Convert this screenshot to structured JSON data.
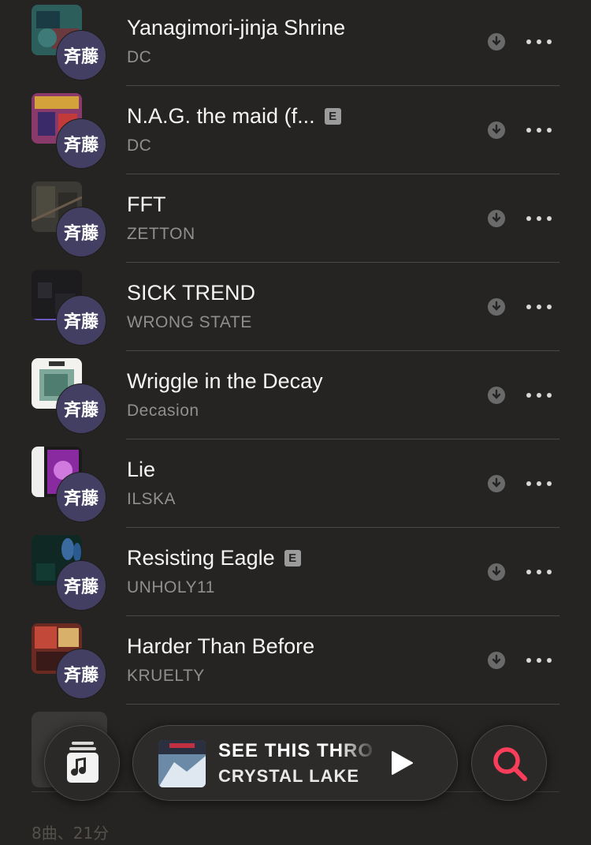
{
  "avatar_text": "斉藤",
  "explicit_badge": "E",
  "tracks": [
    {
      "title": "Yanagimori-jinja Shrine",
      "artist": "DC",
      "explicit": false
    },
    {
      "title": "N.A.G. the maid (f...",
      "artist": "DC",
      "explicit": true
    },
    {
      "title": "FFT",
      "artist": "ZETTON",
      "explicit": false
    },
    {
      "title": "SICK TREND",
      "artist": "WRONG STATE",
      "explicit": false
    },
    {
      "title": "Wriggle in the Decay",
      "artist": "Decasion",
      "explicit": false
    },
    {
      "title": "Lie",
      "artist": "ILSKA",
      "explicit": false
    },
    {
      "title": "Resisting Eagle",
      "artist": "UNHOLY11",
      "explicit": true
    },
    {
      "title": "Harder Than Before",
      "artist": "KRUELTY",
      "explicit": false
    }
  ],
  "footer": {
    "summary": "8曲、21分"
  },
  "now_playing": {
    "title": "SEE THIS THRO",
    "artist": "CRYSTAL LAKE"
  },
  "colors": {
    "accent": "#fa3d5a",
    "avatar_bg": "#433f63",
    "background": "#252422"
  },
  "icons": {
    "download": "download-arrow-icon",
    "more": "ellipsis-icon",
    "library": "music-note-library-icon",
    "play": "play-icon",
    "search": "search-icon"
  }
}
